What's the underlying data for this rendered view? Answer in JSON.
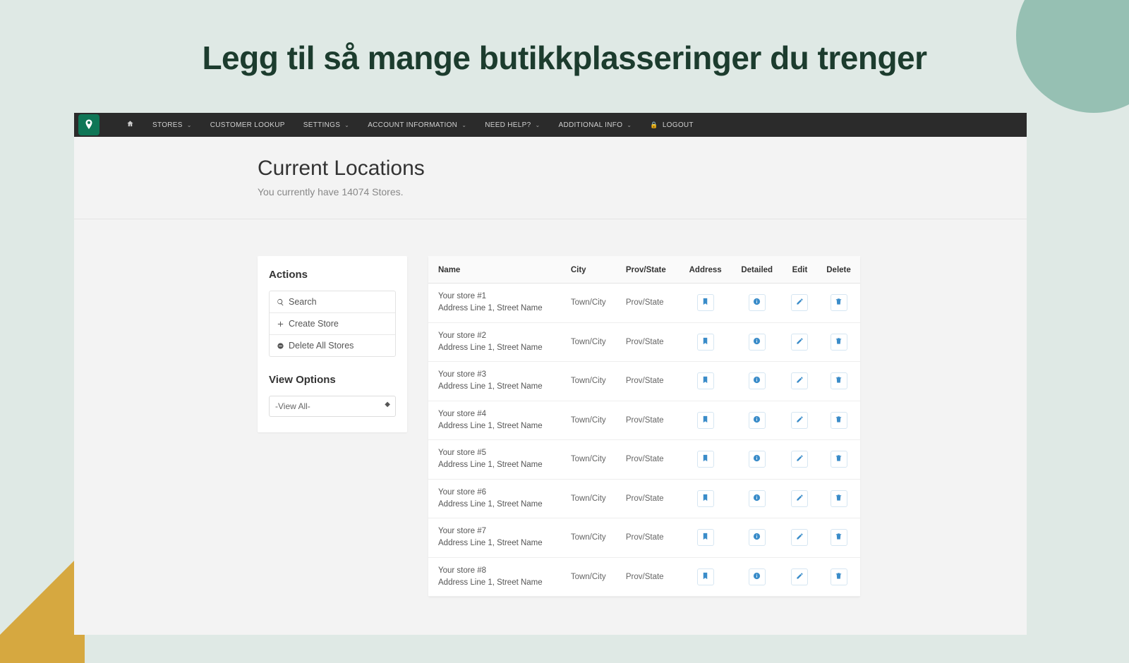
{
  "headline": "Legg til så mange butikkplasseringer du trenger",
  "nav": {
    "items": [
      {
        "label": "STORES",
        "caret": true
      },
      {
        "label": "CUSTOMER LOOKUP",
        "caret": false
      },
      {
        "label": "SETTINGS",
        "caret": true
      },
      {
        "label": "ACCOUNT INFORMATION",
        "caret": true
      },
      {
        "label": "NEED HELP?",
        "caret": true
      },
      {
        "label": "ADDITIONAL INFO",
        "caret": true
      }
    ],
    "logout": "LOGOUT"
  },
  "page": {
    "title": "Current Locations",
    "sub_prefix": "You currently have ",
    "store_count": "14074",
    "sub_suffix": " Stores."
  },
  "actions": {
    "heading": "Actions",
    "search": "Search",
    "create": "Create Store",
    "delete_all": "Delete All Stores"
  },
  "view": {
    "heading": "View Options",
    "selected": "-View All-"
  },
  "table": {
    "headers": {
      "name": "Name",
      "city": "City",
      "prov": "Prov/State",
      "address": "Address",
      "detailed": "Detailed",
      "edit": "Edit",
      "delete": "Delete"
    },
    "rows": [
      {
        "name": "Your store #1",
        "addr": "Address Line 1, Street Name",
        "city": "Town/City",
        "prov": "Prov/State"
      },
      {
        "name": "Your store #2",
        "addr": "Address Line 1, Street Name",
        "city": "Town/City",
        "prov": "Prov/State"
      },
      {
        "name": "Your store #3",
        "addr": "Address Line 1, Street Name",
        "city": "Town/City",
        "prov": "Prov/State"
      },
      {
        "name": "Your store #4",
        "addr": "Address Line 1, Street Name",
        "city": "Town/City",
        "prov": "Prov/State"
      },
      {
        "name": "Your store #5",
        "addr": "Address Line 1, Street Name",
        "city": "Town/City",
        "prov": "Prov/State"
      },
      {
        "name": "Your store #6",
        "addr": "Address Line 1, Street Name",
        "city": "Town/City",
        "prov": "Prov/State"
      },
      {
        "name": "Your store #7",
        "addr": "Address Line 1, Street Name",
        "city": "Town/City",
        "prov": "Prov/State"
      },
      {
        "name": "Your store #8",
        "addr": "Address Line 1, Street Name",
        "city": "Town/City",
        "prov": "Prov/State"
      }
    ]
  }
}
